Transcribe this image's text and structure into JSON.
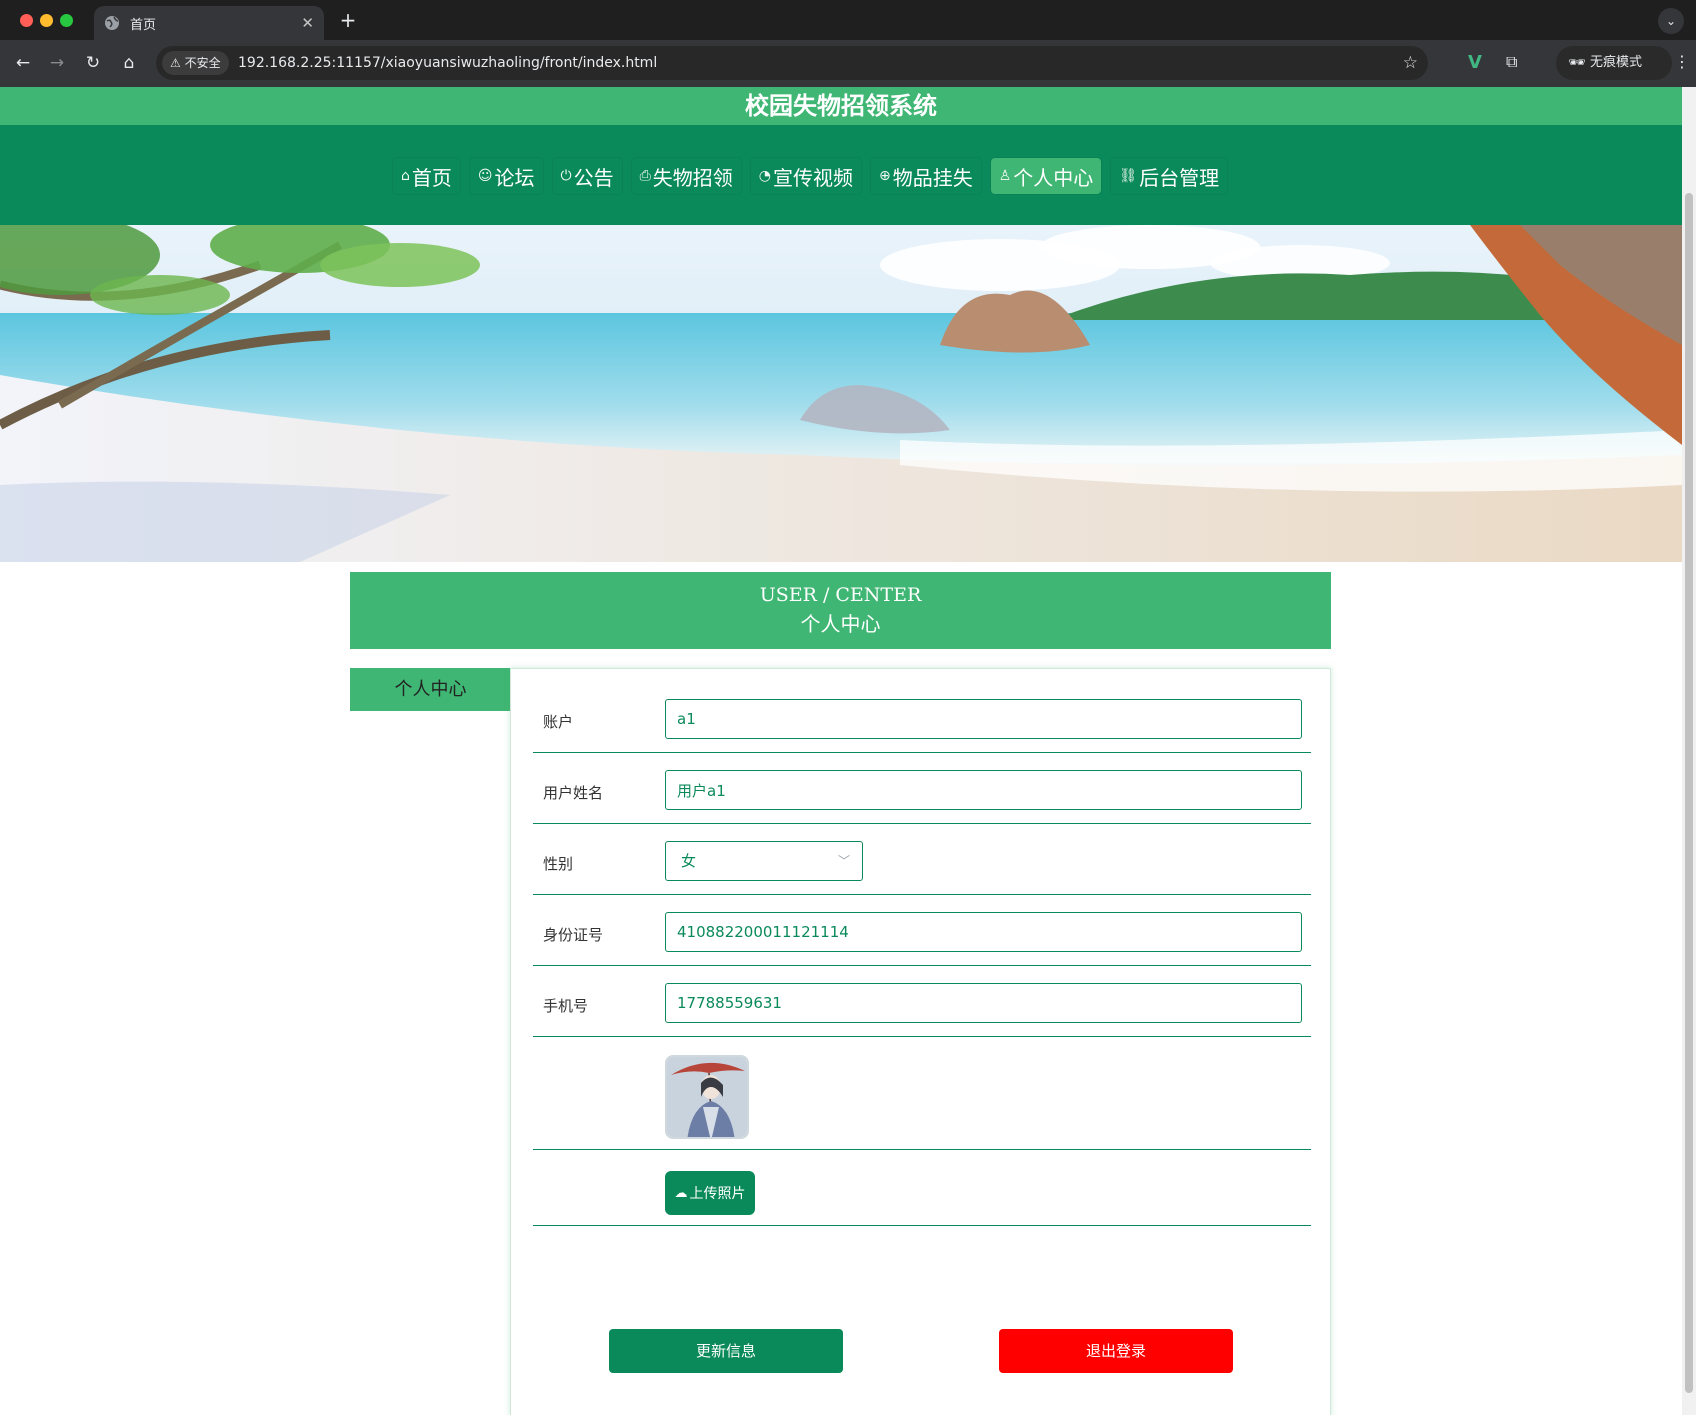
{
  "browser": {
    "tab_title": "首页",
    "new_tab": "+",
    "security_label": "不安全",
    "url": "192.168.2.25:11157/xiaoyuansiwuzhaoling/front/index.html",
    "incognito_label": "无痕模式"
  },
  "site": {
    "title": "校园失物招领系统"
  },
  "nav": {
    "items": [
      {
        "label": "首页",
        "icon": "home-icon",
        "glyph": "⌂"
      },
      {
        "label": "论坛",
        "icon": "forum-icon",
        "glyph": "☺"
      },
      {
        "label": "公告",
        "icon": "power-icon",
        "glyph": "⏻"
      },
      {
        "label": "失物招领",
        "icon": "printer-icon",
        "glyph": "⎙"
      },
      {
        "label": "宣传视频",
        "icon": "gauge-icon",
        "glyph": "◔"
      },
      {
        "label": "物品挂失",
        "icon": "globe-icon",
        "glyph": "⊕"
      },
      {
        "label": "个人中心",
        "icon": "user-icon",
        "glyph": "♙",
        "active": true
      },
      {
        "label": "后台管理",
        "icon": "link-icon",
        "glyph": "⛓"
      }
    ]
  },
  "banner": {
    "slide_count": 3,
    "active_slide": 2
  },
  "user_center": {
    "title_en": "USER / CENTER",
    "title_cn": "个人中心",
    "side_tab": "个人中心"
  },
  "form": {
    "account_label": "账户",
    "account_value": "a1",
    "name_label": "用户姓名",
    "name_value": "用户a1",
    "gender_label": "性别",
    "gender_value": "女",
    "id_label": "身份证号",
    "id_value": "410882200011121114",
    "phone_label": "手机号",
    "phone_value": "17788559631",
    "upload_label": "上传照片",
    "update_label": "更新信息",
    "logout_label": "退出登录"
  },
  "colors": {
    "primary": "#0a8a5a",
    "accent": "#3fb673",
    "danger": "#ff0000"
  }
}
